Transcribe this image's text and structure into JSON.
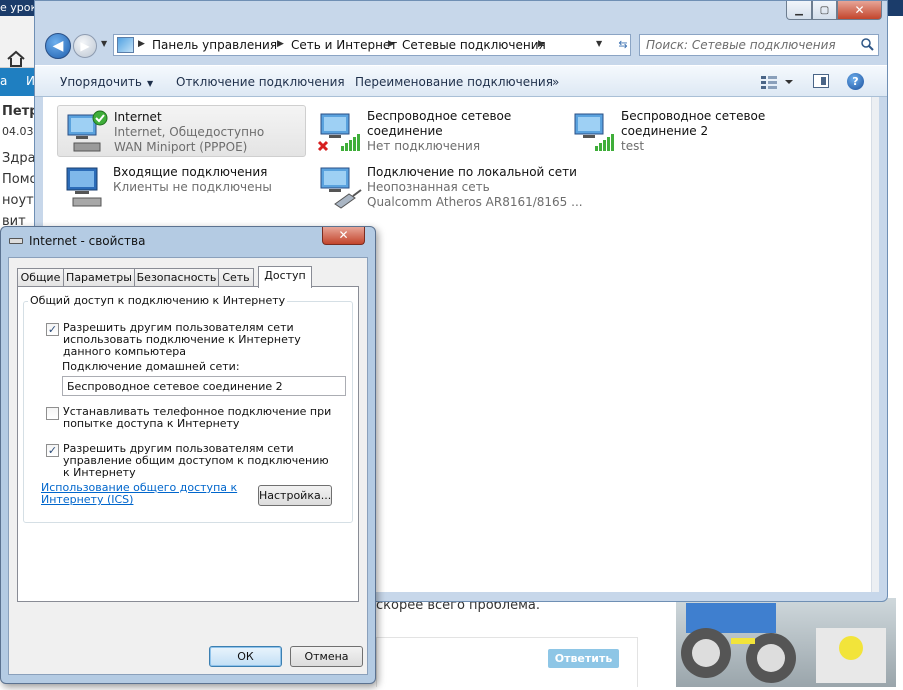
{
  "background_page": {
    "title_fragment": "е урок",
    "nav_item": "а",
    "nav_item2": "И",
    "lines": [
      "Петр",
      "04.03.",
      "Здра",
      "Помо",
      "ноут",
      "вит"
    ],
    "below_dialog_text": "скорее всего проблема.",
    "reply_button": "Ответить"
  },
  "explorer": {
    "breadcrumbs": [
      "Панель управления",
      "Сеть и Интернет",
      "Сетевые подключения"
    ],
    "search_placeholder": "Поиск: Сетевые подключения",
    "commands": {
      "organize": "Упорядочить",
      "disconnect": "Отключение подключения",
      "rename": "Переименование подключения",
      "more": "»"
    },
    "connections": [
      {
        "name": "Internet",
        "line2": "Internet, Общедоступно",
        "line3": "WAN Miniport (PPPOE)",
        "status": "connected"
      },
      {
        "name": "Беспроводное сетевое",
        "line2": "соединение",
        "line3": "Нет подключения",
        "status": "disconnected"
      },
      {
        "name": "Беспроводное сетевое",
        "line2": "соединение 2",
        "line3": "test",
        "status": "wireless"
      },
      {
        "name": "Входящие подключения",
        "line2": "Клиенты не подключены",
        "line3": "",
        "status": "incoming"
      },
      {
        "name": "Подключение по локальной сети",
        "line2": "Неопознанная сеть",
        "line3": "Qualcomm Atheros AR8161/8165 ...",
        "status": "lan"
      }
    ]
  },
  "dialog": {
    "title": "Internet - свойства",
    "tabs": [
      "Общие",
      "Параметры",
      "Безопасность",
      "Сеть",
      "Доступ"
    ],
    "active_tab": "Доступ",
    "group_title": "Общий доступ к подключению к Интернету",
    "options": [
      {
        "label": "Разрешить другим пользователям сети использовать подключение к Интернету данного компьютера",
        "checked": true
      },
      {
        "label": "Устанавливать телефонное подключение при попытке доступа к Интернету",
        "checked": false
      },
      {
        "label": "Разрешить другим пользователям сети управление общим доступом к подключению к Интернету",
        "checked": true
      }
    ],
    "home_network_label": "Подключение домашней сети:",
    "home_network_value": "Беспроводное сетевое соединение 2",
    "ics_link": "Использование общего доступа к Интернету (ICS)",
    "settings_button": "Настройка...",
    "ok_button": "ОК",
    "cancel_button": "Отмена"
  },
  "colors": {
    "accent": "#1f7fc1",
    "window_frame": "#c7d7ea",
    "link": "#0066cc",
    "close_button": "#c3452c"
  }
}
